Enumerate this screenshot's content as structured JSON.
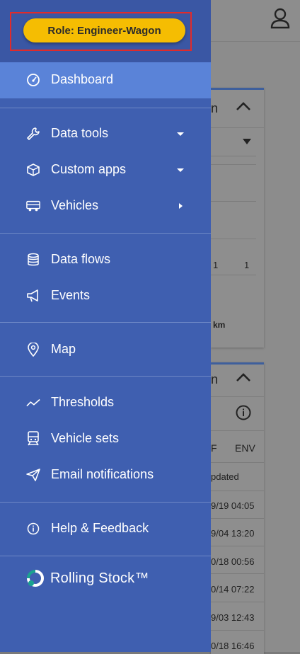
{
  "role": {
    "label": "Role: Engineer-Wagon"
  },
  "nav": {
    "dashboard": "Dashboard",
    "data_tools": "Data tools",
    "custom_apps": "Custom apps",
    "vehicles": "Vehicles",
    "data_flows": "Data flows",
    "events": "Events",
    "map": "Map",
    "thresholds": "Thresholds",
    "vehicle_sets": "Vehicle sets",
    "email_notifications": "Email notifications",
    "help_feedback": "Help & Feedback"
  },
  "brand": {
    "name": "Rolling Stock™"
  },
  "background": {
    "card1_header_fragment": "n",
    "value_1a": "1",
    "value_1b": "1",
    "unit": "km",
    "card2_header_fragment": "n",
    "column_partial": "F",
    "column_env": "ENV",
    "updated_partial": "pdated",
    "timestamps": [
      "9/19 04:05",
      "9/04 13:20",
      "0/18 00:56",
      "0/14 07:22",
      "9/03 12:43",
      "0/18 16:46"
    ]
  },
  "colors": {
    "drawer": "#3f5fb0",
    "active_item": "#5a83d8",
    "role_pill": "#f5bd02",
    "highlight": "#e02b2b"
  }
}
